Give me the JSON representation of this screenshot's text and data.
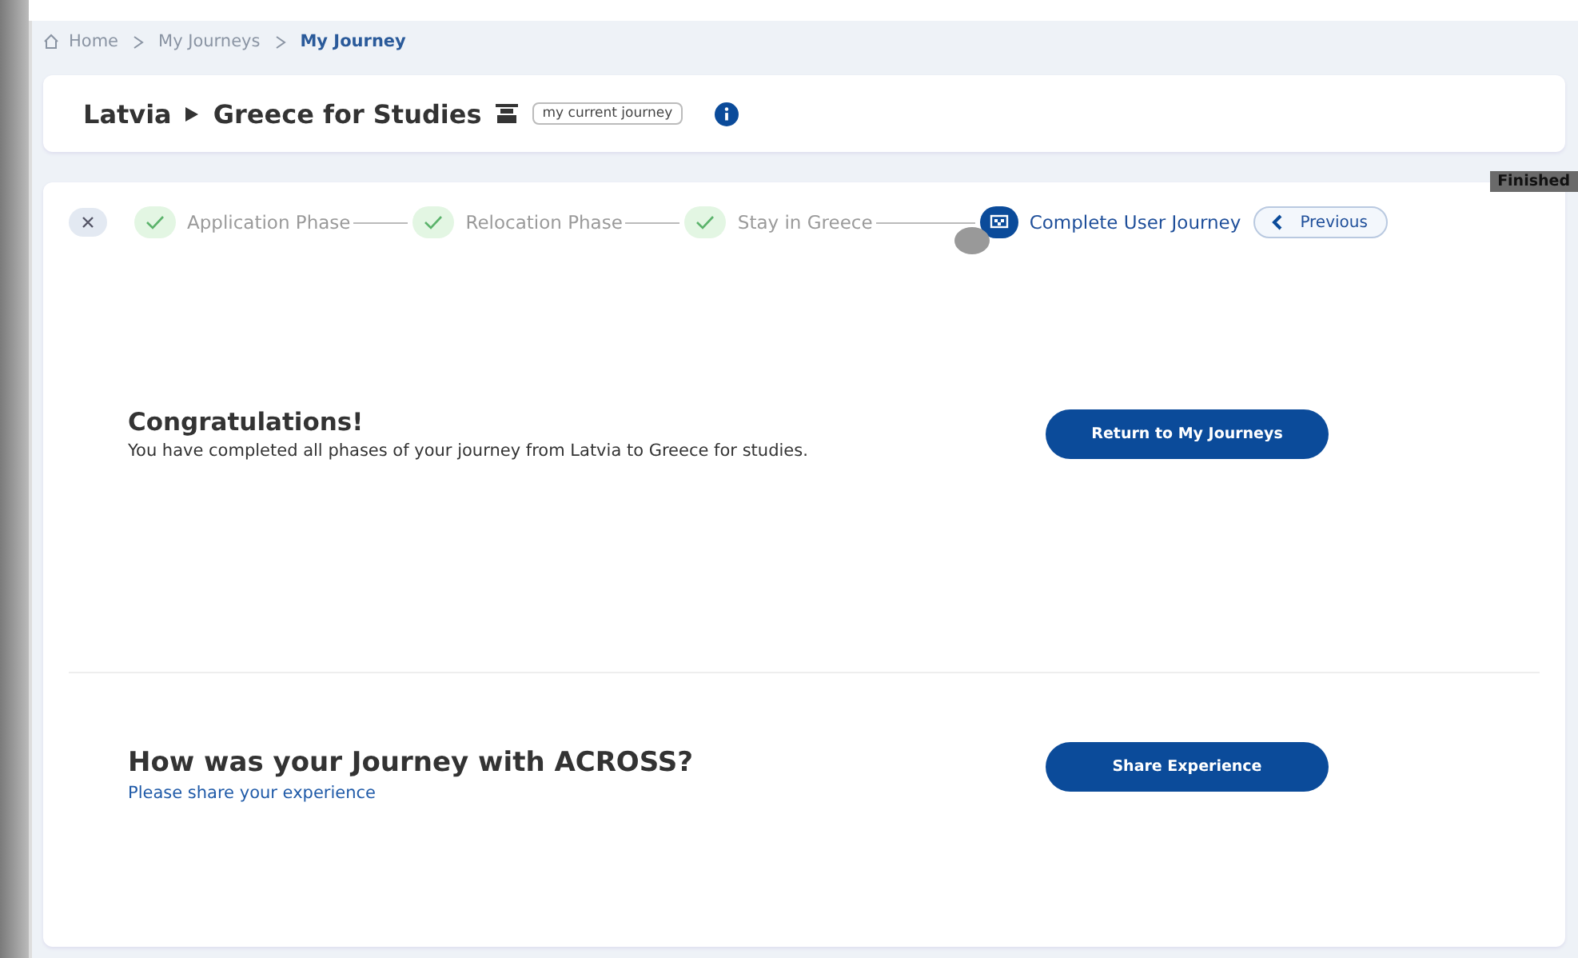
{
  "breadcrumb": [
    {
      "label": "Home",
      "current": false
    },
    {
      "label": "My Journeys",
      "current": false
    },
    {
      "label": "My Journey",
      "current": true
    }
  ],
  "header": {
    "origin": "Latvia",
    "destination": "Greece for Studies",
    "badge": "my current journey"
  },
  "tooltip": "Finished",
  "steps": [
    {
      "label": "Application Phase",
      "selected": false,
      "completed": true
    },
    {
      "label": "Relocation Phase",
      "selected": false,
      "completed": true
    },
    {
      "label": "Stay in Greece",
      "selected": false,
      "completed": true
    },
    {
      "label": "Complete User Journey",
      "selected": true,
      "completed": false
    }
  ],
  "previous_button": "Previous",
  "sections": [
    {
      "title": "Congratulations!",
      "text": "You have completed all phases of your journey from Latvia to Greece for studies.",
      "kind": "plain",
      "button": "Return to My Journeys"
    },
    {
      "title": "How was your Journey with ACROSS?",
      "text": "Please share your experience",
      "kind": "link",
      "button": "Share Experience"
    }
  ]
}
